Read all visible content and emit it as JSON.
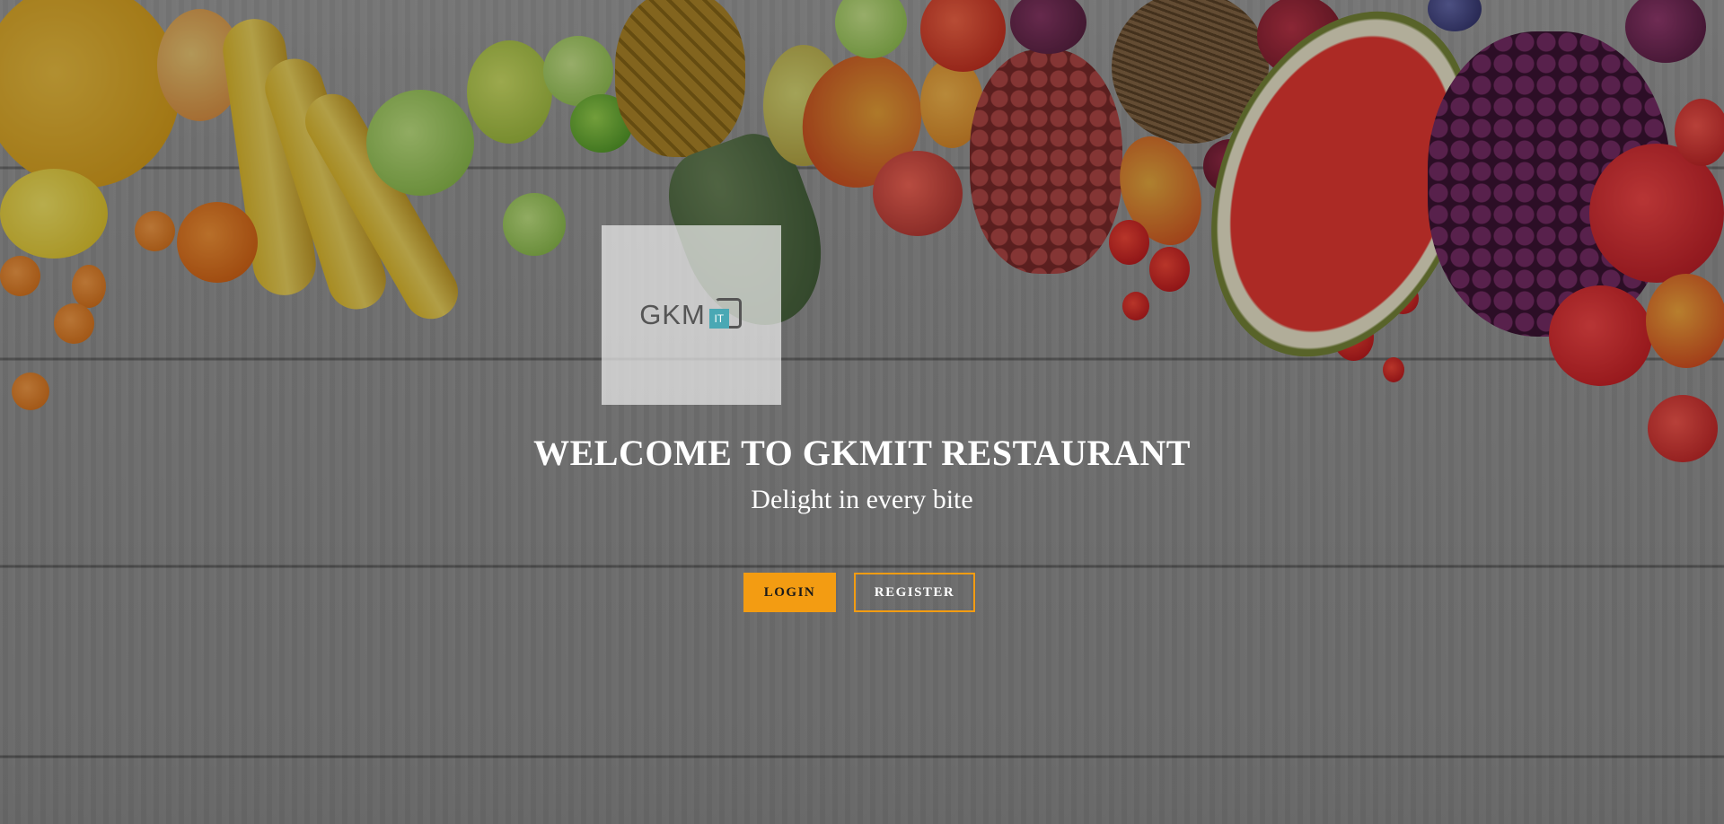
{
  "logo": {
    "text": "GKM",
    "badge": "IT"
  },
  "hero": {
    "title": "WELCOME TO GKMIT RESTAURANT",
    "subtitle": "Delight in every bite"
  },
  "actions": {
    "login_label": "LOGIN",
    "register_label": "REGISTER"
  },
  "colors": {
    "accent": "#f39c12",
    "logo_teal": "#4aa8b4",
    "overlay": "rgba(0,0,0,0.28)"
  },
  "background": {
    "description_icon": "fruit-on-wooden-table-image"
  }
}
